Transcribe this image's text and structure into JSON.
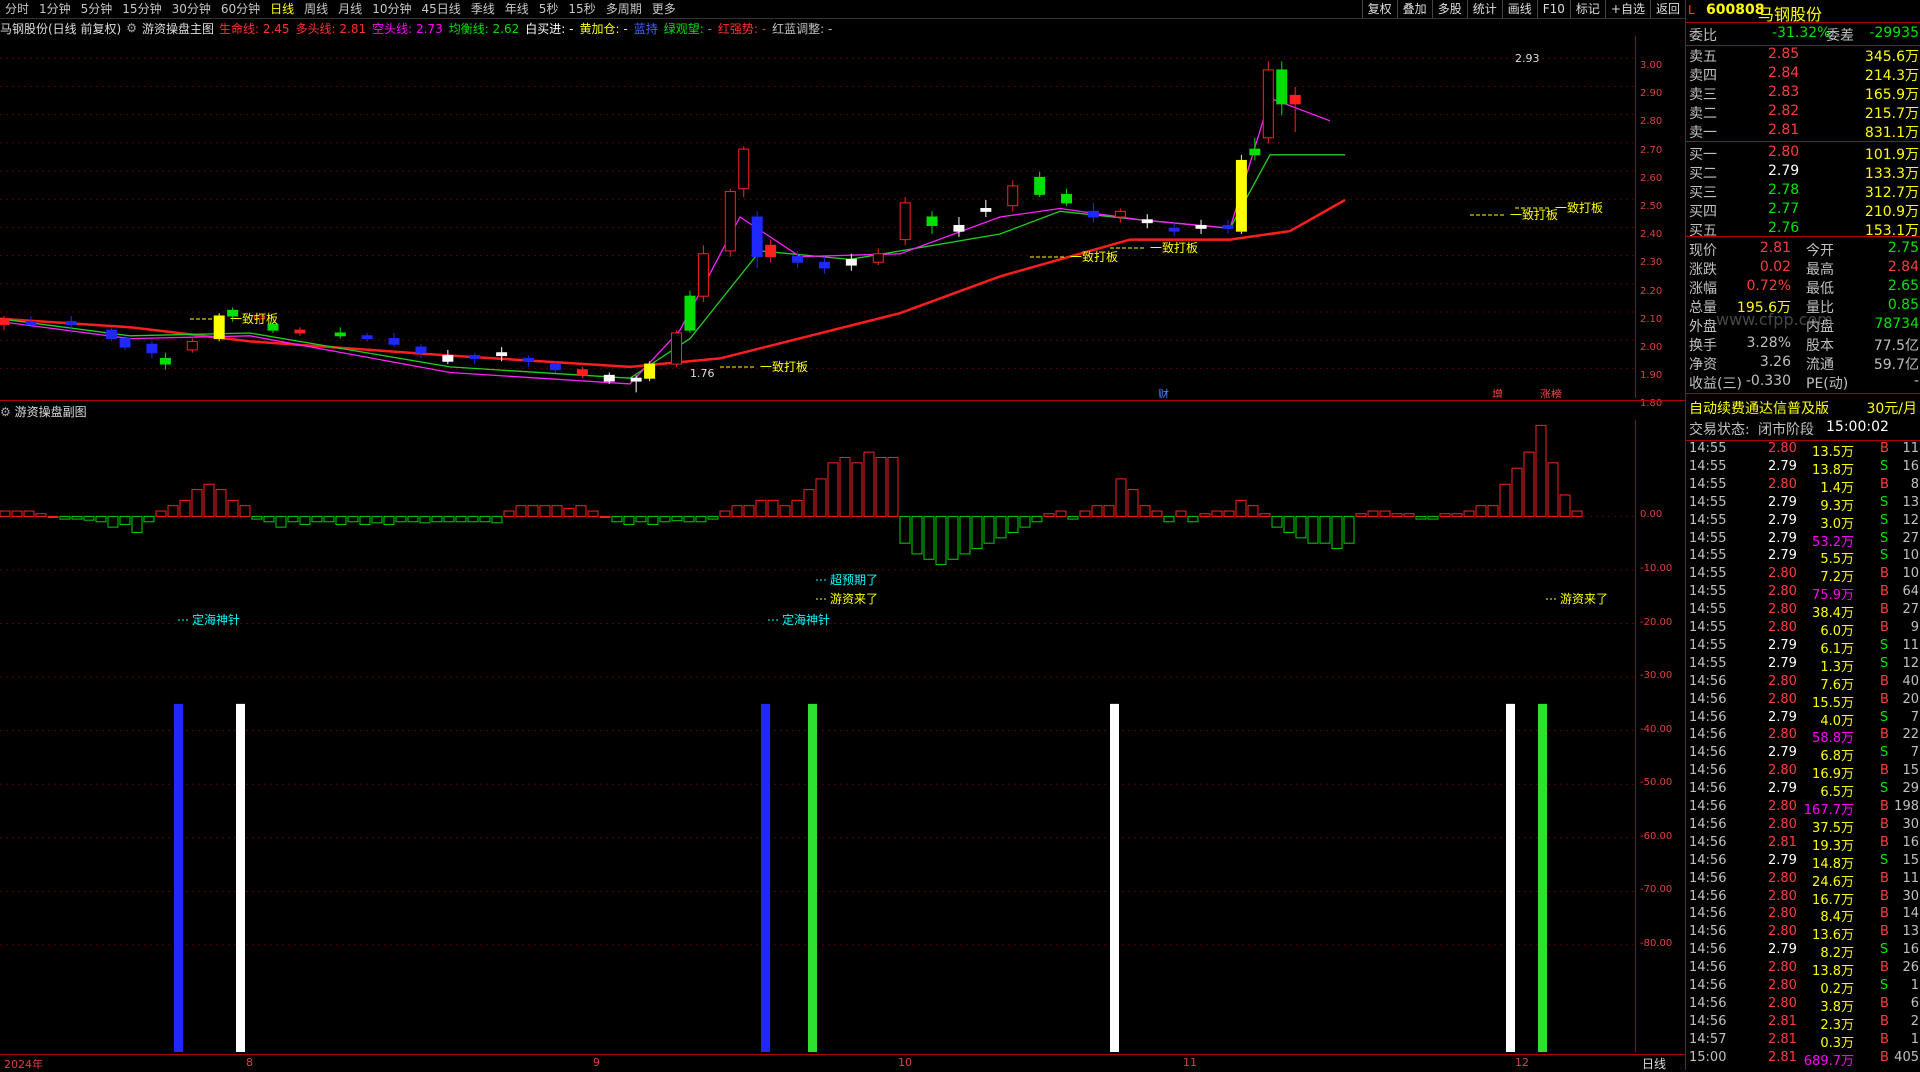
{
  "topbar": {
    "periods": [
      "分时",
      "1分钟",
      "5分钟",
      "15分钟",
      "30分钟",
      "60分钟",
      "日线",
      "周线",
      "月线",
      "10分钟",
      "45日线",
      "季线",
      "年线",
      "5秒",
      "15秒",
      "多周期",
      "更多"
    ],
    "active_period": "日线",
    "right_tools": [
      "复权",
      "叠加",
      "多股",
      "统计",
      "画线",
      "F10",
      "标记",
      "+自选",
      "返回"
    ]
  },
  "indicator_line": {
    "stock_title": "马钢股份(日线 前复权)",
    "main_name": "游资操盘主图",
    "items": [
      {
        "text": "生命线: 2.45",
        "color": "#ff3030"
      },
      {
        "text": "多头线: 2.81",
        "color": "#ff3030"
      },
      {
        "text": "空头线: 2.73",
        "color": "#ff00ff"
      },
      {
        "text": "均衡线: 2.62",
        "color": "#00e000"
      },
      {
        "text": "白买进: -",
        "color": "#ffffff"
      },
      {
        "text": "黄加仓: -",
        "color": "#ffff00"
      },
      {
        "text": "蓝持",
        "color": "#4060ff"
      },
      {
        "text": "绿观望: -",
        "color": "#00e000"
      },
      {
        "text": "红强势: -",
        "color": "#ff3030"
      },
      {
        "text": "红蓝调整: -",
        "color": "#c0c0c0"
      }
    ]
  },
  "main_axis_labels": [
    "3.00",
    "2.90",
    "2.80",
    "2.70",
    "2.60",
    "2.50",
    "2.40",
    "2.30",
    "2.20",
    "2.10",
    "2.00",
    "1.90",
    "1.80"
  ],
  "main_chart": {
    "high_label": "2.93",
    "low_label": "1.76",
    "annotations": [
      "一致打板",
      "一致打板",
      "一致打板",
      "一致打板",
      "一致打板",
      "一致打板"
    ],
    "event_tags": [
      "财",
      "增",
      "涨榜"
    ],
    "ylim": [
      1.74,
      3.02
    ],
    "life_line": [
      [
        0,
        2.02
      ],
      [
        130,
        1.99
      ],
      [
        250,
        1.94
      ],
      [
        450,
        1.89
      ],
      [
        630,
        1.85
      ],
      [
        720,
        1.88
      ],
      [
        900,
        2.04
      ],
      [
        1000,
        2.17
      ],
      [
        1130,
        2.3
      ],
      [
        1230,
        2.3
      ],
      [
        1290,
        2.33
      ],
      [
        1345,
        2.44
      ]
    ],
    "bull_line": [
      [
        0,
        2.01
      ],
      [
        130,
        1.95
      ],
      [
        250,
        1.96
      ],
      [
        450,
        1.83
      ],
      [
        630,
        1.79
      ],
      [
        680,
        1.98
      ],
      [
        740,
        2.38
      ],
      [
        800,
        2.24
      ],
      [
        900,
        2.25
      ],
      [
        1000,
        2.38
      ],
      [
        1060,
        2.41
      ],
      [
        1140,
        2.37
      ],
      [
        1230,
        2.34
      ],
      [
        1270,
        2.8
      ],
      [
        1330,
        2.72
      ]
    ],
    "bear_line": [
      [
        0,
        2.02
      ],
      [
        130,
        1.96
      ],
      [
        250,
        1.97
      ],
      [
        450,
        1.85
      ],
      [
        630,
        1.81
      ],
      [
        690,
        1.95
      ],
      [
        760,
        2.26
      ],
      [
        850,
        2.23
      ],
      [
        1000,
        2.32
      ],
      [
        1060,
        2.4
      ],
      [
        1140,
        2.37
      ],
      [
        1230,
        2.34
      ],
      [
        1270,
        2.6
      ],
      [
        1345,
        2.6
      ]
    ],
    "candles": [
      [
        0.0,
        2.02,
        2.0,
        2.03,
        1.98,
        "red"
      ],
      [
        0.02,
        2.0,
        2.01,
        2.03,
        1.99,
        "blue"
      ],
      [
        0.05,
        2.01,
        2.0,
        2.03,
        1.97,
        "blue"
      ],
      [
        0.08,
        1.98,
        1.95,
        1.99,
        1.94,
        "blue"
      ],
      [
        0.09,
        1.95,
        1.92,
        1.96,
        1.91,
        "blue"
      ],
      [
        0.11,
        1.93,
        1.9,
        1.94,
        1.88,
        "blue"
      ],
      [
        0.12,
        1.88,
        1.86,
        1.9,
        1.84,
        "green"
      ],
      [
        0.14,
        1.91,
        1.94,
        1.95,
        1.9,
        "red"
      ],
      [
        0.16,
        1.95,
        2.03,
        2.04,
        1.94,
        "yellow"
      ],
      [
        0.17,
        2.03,
        2.05,
        2.06,
        2.01,
        "green"
      ],
      [
        0.19,
        2.02,
        2.03,
        2.04,
        2.0,
        "red"
      ],
      [
        0.2,
        2.0,
        1.98,
        2.01,
        1.97,
        "green"
      ],
      [
        0.22,
        1.98,
        1.97,
        1.99,
        1.96,
        "red"
      ],
      [
        0.25,
        1.97,
        1.96,
        1.99,
        1.95,
        "green"
      ],
      [
        0.27,
        1.96,
        1.95,
        1.97,
        1.94,
        "blue"
      ],
      [
        0.29,
        1.95,
        1.93,
        1.97,
        1.92,
        "blue"
      ],
      [
        0.31,
        1.92,
        1.9,
        1.93,
        1.88,
        "blue"
      ],
      [
        0.33,
        1.89,
        1.87,
        1.91,
        1.86,
        "white"
      ],
      [
        0.35,
        1.88,
        1.89,
        1.9,
        1.86,
        "blue"
      ],
      [
        0.37,
        1.9,
        1.89,
        1.92,
        1.87,
        "white"
      ],
      [
        0.39,
        1.88,
        1.87,
        1.89,
        1.85,
        "blue"
      ],
      [
        0.41,
        1.86,
        1.84,
        1.87,
        1.83,
        "blue"
      ],
      [
        0.43,
        1.84,
        1.82,
        1.85,
        1.81,
        "red"
      ],
      [
        0.45,
        1.82,
        1.8,
        1.83,
        1.79,
        "white"
      ],
      [
        0.47,
        1.8,
        1.81,
        1.82,
        1.76,
        "white"
      ],
      [
        0.48,
        1.81,
        1.86,
        1.87,
        1.8,
        "yellow"
      ],
      [
        0.5,
        1.86,
        1.97,
        1.98,
        1.85,
        "red"
      ],
      [
        0.51,
        1.98,
        2.1,
        2.12,
        1.97,
        "green"
      ],
      [
        0.52,
        2.1,
        2.25,
        2.28,
        2.08,
        "red"
      ],
      [
        0.54,
        2.26,
        2.47,
        2.48,
        2.24,
        "red"
      ],
      [
        0.55,
        2.48,
        2.62,
        2.63,
        2.45,
        "red"
      ],
      [
        0.56,
        2.38,
        2.24,
        2.4,
        2.2,
        "blue"
      ],
      [
        0.57,
        2.28,
        2.24,
        2.3,
        2.22,
        "red"
      ],
      [
        0.59,
        2.24,
        2.22,
        2.26,
        2.2,
        "blue"
      ],
      [
        0.61,
        2.22,
        2.2,
        2.24,
        2.18,
        "blue"
      ],
      [
        0.63,
        2.21,
        2.23,
        2.25,
        2.19,
        "white"
      ],
      [
        0.65,
        2.22,
        2.25,
        2.27,
        2.21,
        "red"
      ],
      [
        0.67,
        2.3,
        2.43,
        2.45,
        2.28,
        "red"
      ],
      [
        0.69,
        2.38,
        2.35,
        2.4,
        2.32,
        "green"
      ],
      [
        0.71,
        2.35,
        2.33,
        2.38,
        2.31,
        "white"
      ],
      [
        0.73,
        2.4,
        2.41,
        2.44,
        2.38,
        "white"
      ],
      [
        0.75,
        2.42,
        2.49,
        2.51,
        2.4,
        "red"
      ],
      [
        0.77,
        2.46,
        2.52,
        2.54,
        2.45,
        "green"
      ],
      [
        0.79,
        2.46,
        2.43,
        2.48,
        2.42,
        "green"
      ],
      [
        0.81,
        2.4,
        2.38,
        2.43,
        2.36,
        "blue"
      ],
      [
        0.83,
        2.38,
        2.4,
        2.41,
        2.36,
        "red"
      ],
      [
        0.85,
        2.37,
        2.36,
        2.39,
        2.34,
        "white"
      ],
      [
        0.87,
        2.34,
        2.33,
        2.36,
        2.31,
        "blue"
      ],
      [
        0.89,
        2.34,
        2.35,
        2.37,
        2.32,
        "white"
      ],
      [
        0.91,
        2.34,
        2.35,
        2.37,
        2.32,
        "blue"
      ],
      [
        0.92,
        2.33,
        2.58,
        2.6,
        2.32,
        "yellow"
      ],
      [
        0.93,
        2.6,
        2.62,
        2.66,
        2.58,
        "green"
      ],
      [
        0.94,
        2.66,
        2.9,
        2.93,
        2.64,
        "red"
      ],
      [
        0.95,
        2.9,
        2.78,
        2.93,
        2.74,
        "green"
      ],
      [
        0.96,
        2.81,
        2.78,
        2.84,
        2.68,
        "red"
      ]
    ]
  },
  "sub_chart": {
    "title": "游资操盘副图",
    "axis_labels": [
      "0.00",
      "-10.00",
      "-20.00",
      "-30.00",
      "-40.00",
      "-50.00",
      "-60.00",
      "-70.00",
      "-80.00"
    ],
    "ylim": [
      -100,
      18
    ],
    "labels": [
      "定海神针",
      "定海神针",
      "超预期了",
      "游资来了",
      "游资来了"
    ]
  },
  "bottom_axis": {
    "labels": [
      "2024年",
      "8",
      "9",
      "10",
      "11",
      "12"
    ],
    "period": "日线"
  },
  "quote": {
    "code": "600808",
    "name": "马钢股份",
    "market_tag": "L",
    "webi_label": "委比",
    "webi_value": "-31.32%",
    "weicha_label": "委差",
    "weicha_value": "-29935",
    "asks": [
      {
        "label": "卖五",
        "price": "2.85",
        "vol": "345.6万"
      },
      {
        "label": "卖四",
        "price": "2.84",
        "vol": "214.3万"
      },
      {
        "label": "卖三",
        "price": "2.83",
        "vol": "165.9万"
      },
      {
        "label": "卖二",
        "price": "2.82",
        "vol": "215.7万"
      },
      {
        "label": "卖一",
        "price": "2.81",
        "vol": "831.1万"
      }
    ],
    "bids": [
      {
        "label": "买一",
        "price": "2.80",
        "vol": "101.9万"
      },
      {
        "label": "买二",
        "price": "2.79",
        "vol": "133.3万"
      },
      {
        "label": "买三",
        "price": "2.78",
        "vol": "312.7万"
      },
      {
        "label": "买四",
        "price": "2.77",
        "vol": "210.9万"
      },
      {
        "label": "买五",
        "price": "2.76",
        "vol": "153.1万"
      }
    ],
    "stats": [
      {
        "l1": "现价",
        "v1": "2.81",
        "l2": "今开",
        "v2": "2.75"
      },
      {
        "l1": "涨跌",
        "v1": "0.02",
        "l2": "最高",
        "v2": "2.84"
      },
      {
        "l1": "涨幅",
        "v1": "0.72%",
        "l2": "最低",
        "v2": "2.65"
      },
      {
        "l1": "总量",
        "v1": "195.6万",
        "l2": "量比",
        "v2": "0.85"
      },
      {
        "l1": "外盘",
        "v1": "",
        "l2": "内盘",
        "v2": "78734"
      },
      {
        "l1": "换手",
        "v1": "3.28%",
        "l2": "股本",
        "v2": "77.5亿"
      },
      {
        "l1": "净资",
        "v1": "3.26",
        "l2": "流通",
        "v2": "59.7亿"
      },
      {
        "l1": "收益(三)",
        "v1": "-0.330",
        "l2": "PE(动)",
        "v2": "-"
      }
    ],
    "watermark": "www.cfpp.com",
    "ad_text": "自动续费通达信普及版",
    "ad_price": "30元/月",
    "trade_state_label": "交易状态:",
    "trade_state": "闭市阶段",
    "trade_time": "15:00:02"
  },
  "ticks": [
    [
      "14:55",
      "2.80",
      "13.5万",
      "B",
      "11"
    ],
    [
      "14:55",
      "2.79",
      "13.8万",
      "S",
      "16"
    ],
    [
      "14:55",
      "2.80",
      "1.4万",
      "B",
      "8"
    ],
    [
      "14:55",
      "2.79",
      "9.3万",
      "S",
      "13"
    ],
    [
      "14:55",
      "2.79",
      "3.0万",
      "S",
      "12"
    ],
    [
      "14:55",
      "2.79",
      "53.2万",
      "S",
      "27"
    ],
    [
      "14:55",
      "2.79",
      "5.5万",
      "S",
      "10"
    ],
    [
      "14:55",
      "2.80",
      "7.2万",
      "B",
      "10"
    ],
    [
      "14:55",
      "2.80",
      "75.9万",
      "B",
      "64"
    ],
    [
      "14:55",
      "2.80",
      "38.4万",
      "B",
      "27"
    ],
    [
      "14:55",
      "2.80",
      "6.0万",
      "B",
      "9"
    ],
    [
      "14:55",
      "2.79",
      "6.1万",
      "S",
      "11"
    ],
    [
      "14:55",
      "2.79",
      "1.3万",
      "S",
      "12"
    ],
    [
      "14:56",
      "2.80",
      "7.6万",
      "B",
      "40"
    ],
    [
      "14:56",
      "2.80",
      "15.5万",
      "B",
      "20"
    ],
    [
      "14:56",
      "2.79",
      "4.0万",
      "S",
      "7"
    ],
    [
      "14:56",
      "2.80",
      "58.8万",
      "B",
      "22"
    ],
    [
      "14:56",
      "2.79",
      "6.8万",
      "S",
      "7"
    ],
    [
      "14:56",
      "2.80",
      "16.9万",
      "B",
      "15"
    ],
    [
      "14:56",
      "2.79",
      "6.5万",
      "S",
      "29"
    ],
    [
      "14:56",
      "2.80",
      "167.7万",
      "B",
      "198"
    ],
    [
      "14:56",
      "2.80",
      "37.5万",
      "B",
      "30"
    ],
    [
      "14:56",
      "2.81",
      "19.3万",
      "B",
      "16"
    ],
    [
      "14:56",
      "2.79",
      "14.8万",
      "S",
      "15"
    ],
    [
      "14:56",
      "2.80",
      "24.6万",
      "B",
      "11"
    ],
    [
      "14:56",
      "2.80",
      "16.7万",
      "B",
      "30"
    ],
    [
      "14:56",
      "2.80",
      "8.4万",
      "B",
      "14"
    ],
    [
      "14:56",
      "2.80",
      "13.6万",
      "B",
      "13"
    ],
    [
      "14:56",
      "2.79",
      "8.2万",
      "S",
      "16"
    ],
    [
      "14:56",
      "2.80",
      "13.8万",
      "B",
      "26"
    ],
    [
      "14:56",
      "2.80",
      "0.2万",
      "S",
      "1"
    ],
    [
      "14:56",
      "2.80",
      "3.8万",
      "B",
      "6"
    ],
    [
      "14:56",
      "2.81",
      "2.3万",
      "B",
      "2"
    ],
    [
      "14:57",
      "2.81",
      "0.3万",
      "B",
      "1"
    ],
    [
      "15:00",
      "2.81",
      "689.7万",
      "B",
      "405"
    ]
  ]
}
